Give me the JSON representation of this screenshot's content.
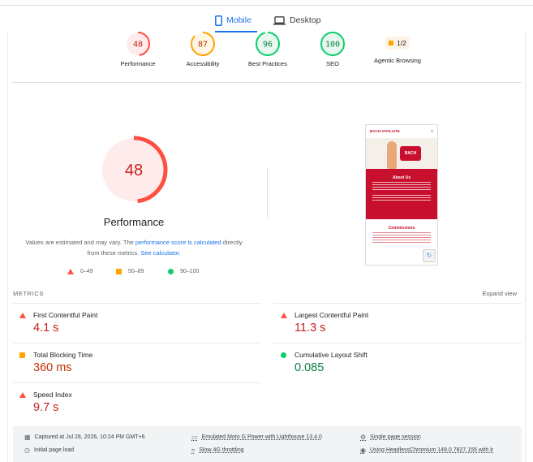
{
  "tabs": [
    {
      "label": "Mobile",
      "active": true,
      "icon": "phone-icon"
    },
    {
      "label": "Desktop",
      "active": false,
      "icon": "laptop-icon"
    }
  ],
  "categories": [
    {
      "score": "48",
      "label": "Performance",
      "level": "fail",
      "value": 48
    },
    {
      "score": "87",
      "label": "Accessibility",
      "level": "average",
      "value": 87
    },
    {
      "score": "96",
      "label": "Best Practices",
      "level": "pass",
      "value": 96
    },
    {
      "score": "100",
      "label": "SEO",
      "level": "pass",
      "value": 100
    },
    {
      "score": "1/2",
      "label": "Agentic Browsing",
      "level": "average"
    }
  ],
  "performance": {
    "score": "48",
    "value": 48,
    "label": "Performance",
    "note_prefix": "Values are estimated and may vary. The ",
    "note_link1": "performance score is calculated",
    "note_middle": " directly from these metrics. ",
    "note_link2": "See calculator.",
    "legend": [
      {
        "range": "0–49",
        "icon": "red-triangle-icon"
      },
      {
        "range": "50–89",
        "icon": "orange-square-icon"
      },
      {
        "range": "90–100",
        "icon": "green-circle-icon"
      }
    ]
  },
  "screenshot": {
    "brand": "BACH AFFILIATE",
    "hero_logo": "BACH",
    "section1": "About Us",
    "section2": "Commissions"
  },
  "metrics": {
    "title": "METRICS",
    "expand": "Expand view",
    "items": [
      {
        "name": "First Contentful Paint",
        "value": "4.1 s",
        "level": "fail"
      },
      {
        "name": "Largest Contentful Paint",
        "value": "11.3 s",
        "level": "fail"
      },
      {
        "name": "Total Blocking Time",
        "value": "360 ms",
        "level": "average"
      },
      {
        "name": "Cumulative Layout Shift",
        "value": "0.085",
        "level": "pass"
      },
      {
        "name": "Speed Index",
        "value": "9.7 s",
        "level": "fail"
      }
    ]
  },
  "footer": {
    "captured": "Captured at Jul 28, 2026, 10:24 PM GMT+6",
    "device": "Emulated Moto G Power with Lighthouse 13.4.0",
    "session": "Single page session",
    "load": "Initial page load",
    "throttle": "Slow 4G throttling",
    "browser": "Using HeadlessChromium 149.0.7827.155 with lr"
  },
  "colors": {
    "fail": "#ff4e42",
    "average": "#ffa400",
    "pass": "#0cce6b",
    "accent": "#1a73e8"
  }
}
